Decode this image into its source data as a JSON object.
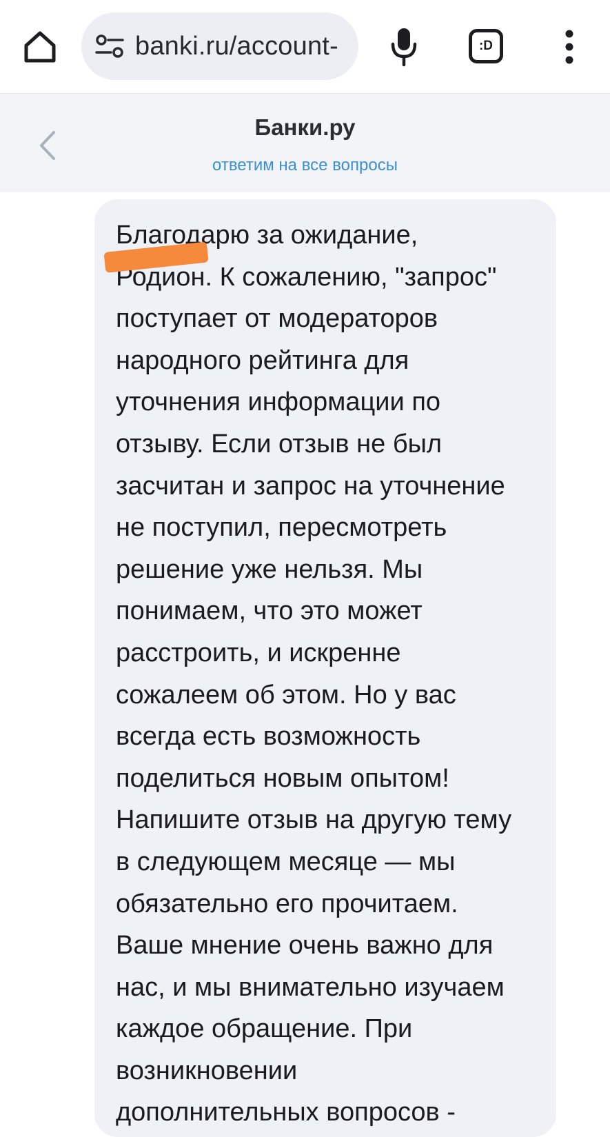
{
  "browser": {
    "url": "banki.ru/account-",
    "icons": {
      "home": "home-icon",
      "site_settings": "tune-icon",
      "voice": "microphone-icon",
      "tabs": "tab-switcher-icon",
      "menu": "more-vertical-icon"
    },
    "tab_label": ":D"
  },
  "chat": {
    "title": "Банки.ру",
    "subtitle": "ответим на все вопросы",
    "back_icon": "chevron-left-icon",
    "accent_color": "#3a8fd6"
  },
  "message": {
    "text": "Благодарю за ожидание,\nРодион. К сожалению, \"запрос\"\nпоступает от модераторов\nнародного рейтинга для\nуточнения информации по\nотзыву. Если отзыв не был\nзасчитан и запрос на уточнение\nне поступил, пересмотреть\nрешение уже нельзя. Мы\nпонимаем, что это может\nрасстроить, и искренне\nсожалеем об этом. Но у вас\nвсегда есть возможность\nподелиться новым опытом!\nНапишите отзыв на другую тему\nв следующем месяце — мы\nобязательно его прочитаем.\nВаше мнение очень важно для\nнас, и мы внимательно изучаем\nкаждое обращение. При\nвозникновении\nдополнительных вопросов -",
    "redaction_color": "#f68a3c"
  }
}
